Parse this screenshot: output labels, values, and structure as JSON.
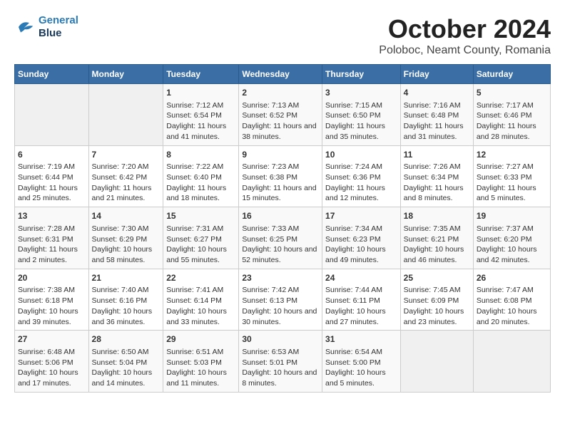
{
  "logo": {
    "line1": "General",
    "line2": "Blue"
  },
  "title": "October 2024",
  "subtitle": "Poloboc, Neamt County, Romania",
  "days_header": [
    "Sunday",
    "Monday",
    "Tuesday",
    "Wednesday",
    "Thursday",
    "Friday",
    "Saturday"
  ],
  "weeks": [
    {
      "cells": [
        {
          "day": null,
          "content": null
        },
        {
          "day": null,
          "content": null
        },
        {
          "day": "1",
          "sunrise": "7:12 AM",
          "sunset": "6:54 PM",
          "daylight": "11 hours and 41 minutes."
        },
        {
          "day": "2",
          "sunrise": "7:13 AM",
          "sunset": "6:52 PM",
          "daylight": "11 hours and 38 minutes."
        },
        {
          "day": "3",
          "sunrise": "7:15 AM",
          "sunset": "6:50 PM",
          "daylight": "11 hours and 35 minutes."
        },
        {
          "day": "4",
          "sunrise": "7:16 AM",
          "sunset": "6:48 PM",
          "daylight": "11 hours and 31 minutes."
        },
        {
          "day": "5",
          "sunrise": "7:17 AM",
          "sunset": "6:46 PM",
          "daylight": "11 hours and 28 minutes."
        }
      ]
    },
    {
      "cells": [
        {
          "day": "6",
          "sunrise": "7:19 AM",
          "sunset": "6:44 PM",
          "daylight": "11 hours and 25 minutes."
        },
        {
          "day": "7",
          "sunrise": "7:20 AM",
          "sunset": "6:42 PM",
          "daylight": "11 hours and 21 minutes."
        },
        {
          "day": "8",
          "sunrise": "7:22 AM",
          "sunset": "6:40 PM",
          "daylight": "11 hours and 18 minutes."
        },
        {
          "day": "9",
          "sunrise": "7:23 AM",
          "sunset": "6:38 PM",
          "daylight": "11 hours and 15 minutes."
        },
        {
          "day": "10",
          "sunrise": "7:24 AM",
          "sunset": "6:36 PM",
          "daylight": "11 hours and 12 minutes."
        },
        {
          "day": "11",
          "sunrise": "7:26 AM",
          "sunset": "6:34 PM",
          "daylight": "11 hours and 8 minutes."
        },
        {
          "day": "12",
          "sunrise": "7:27 AM",
          "sunset": "6:33 PM",
          "daylight": "11 hours and 5 minutes."
        }
      ]
    },
    {
      "cells": [
        {
          "day": "13",
          "sunrise": "7:28 AM",
          "sunset": "6:31 PM",
          "daylight": "11 hours and 2 minutes."
        },
        {
          "day": "14",
          "sunrise": "7:30 AM",
          "sunset": "6:29 PM",
          "daylight": "10 hours and 58 minutes."
        },
        {
          "day": "15",
          "sunrise": "7:31 AM",
          "sunset": "6:27 PM",
          "daylight": "10 hours and 55 minutes."
        },
        {
          "day": "16",
          "sunrise": "7:33 AM",
          "sunset": "6:25 PM",
          "daylight": "10 hours and 52 minutes."
        },
        {
          "day": "17",
          "sunrise": "7:34 AM",
          "sunset": "6:23 PM",
          "daylight": "10 hours and 49 minutes."
        },
        {
          "day": "18",
          "sunrise": "7:35 AM",
          "sunset": "6:21 PM",
          "daylight": "10 hours and 46 minutes."
        },
        {
          "day": "19",
          "sunrise": "7:37 AM",
          "sunset": "6:20 PM",
          "daylight": "10 hours and 42 minutes."
        }
      ]
    },
    {
      "cells": [
        {
          "day": "20",
          "sunrise": "7:38 AM",
          "sunset": "6:18 PM",
          "daylight": "10 hours and 39 minutes."
        },
        {
          "day": "21",
          "sunrise": "7:40 AM",
          "sunset": "6:16 PM",
          "daylight": "10 hours and 36 minutes."
        },
        {
          "day": "22",
          "sunrise": "7:41 AM",
          "sunset": "6:14 PM",
          "daylight": "10 hours and 33 minutes."
        },
        {
          "day": "23",
          "sunrise": "7:42 AM",
          "sunset": "6:13 PM",
          "daylight": "10 hours and 30 minutes."
        },
        {
          "day": "24",
          "sunrise": "7:44 AM",
          "sunset": "6:11 PM",
          "daylight": "10 hours and 27 minutes."
        },
        {
          "day": "25",
          "sunrise": "7:45 AM",
          "sunset": "6:09 PM",
          "daylight": "10 hours and 23 minutes."
        },
        {
          "day": "26",
          "sunrise": "7:47 AM",
          "sunset": "6:08 PM",
          "daylight": "10 hours and 20 minutes."
        }
      ]
    },
    {
      "cells": [
        {
          "day": "27",
          "sunrise": "6:48 AM",
          "sunset": "5:06 PM",
          "daylight": "10 hours and 17 minutes."
        },
        {
          "day": "28",
          "sunrise": "6:50 AM",
          "sunset": "5:04 PM",
          "daylight": "10 hours and 14 minutes."
        },
        {
          "day": "29",
          "sunrise": "6:51 AM",
          "sunset": "5:03 PM",
          "daylight": "10 hours and 11 minutes."
        },
        {
          "day": "30",
          "sunrise": "6:53 AM",
          "sunset": "5:01 PM",
          "daylight": "10 hours and 8 minutes."
        },
        {
          "day": "31",
          "sunrise": "6:54 AM",
          "sunset": "5:00 PM",
          "daylight": "10 hours and 5 minutes."
        },
        {
          "day": null,
          "content": null
        },
        {
          "day": null,
          "content": null
        }
      ]
    }
  ],
  "labels": {
    "sunrise": "Sunrise: ",
    "sunset": "Sunset: ",
    "daylight": "Daylight: "
  }
}
